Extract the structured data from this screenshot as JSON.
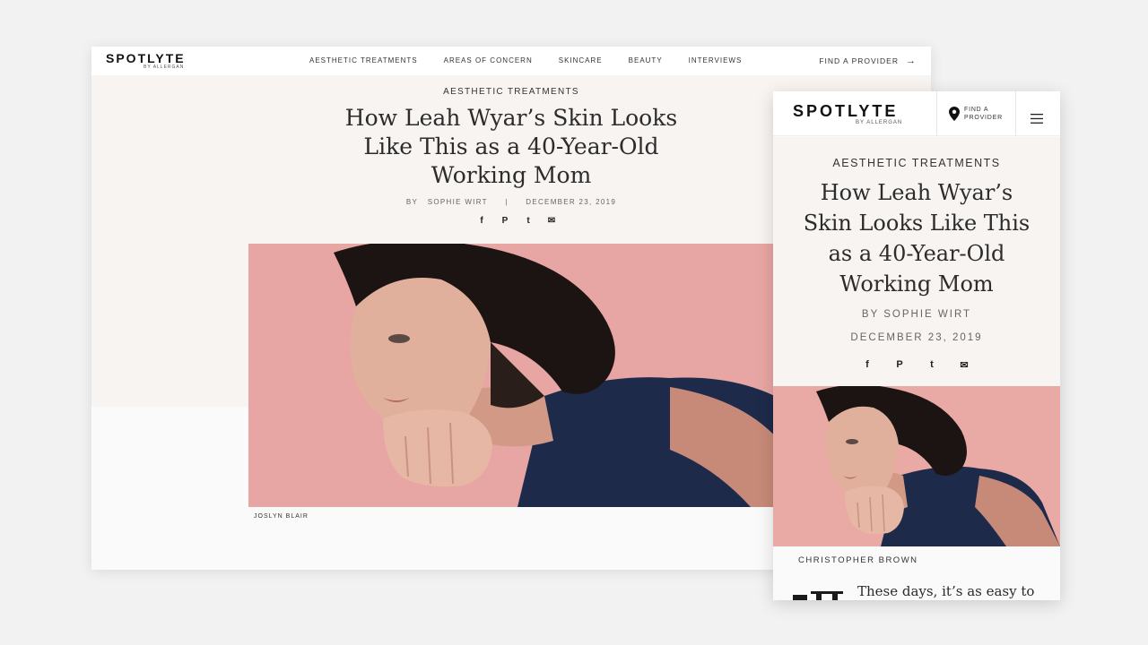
{
  "desktop": {
    "logo": {
      "wordmark": "SPOTLYTE",
      "sub": "BY ALLERGAN"
    },
    "nav": [
      "AESTHETIC TREATMENTS",
      "AREAS OF CONCERN",
      "SKINCARE",
      "BEAUTY",
      "INTERVIEWS"
    ],
    "find_provider": "FIND A PROVIDER",
    "find_provider_arrow": "→",
    "article": {
      "category": "AESTHETIC TREATMENTS",
      "title": "How Leah Wyar’s Skin Looks Like This as a 40-Year-Old Working Mom",
      "by": "BY",
      "author": "SOPHIE WIRT",
      "separator": "|",
      "date": "DECEMBER 23, 2019",
      "share": [
        "f",
        "P",
        "t",
        "✉"
      ],
      "photo_caption": "JOSLYN BLAIR"
    }
  },
  "mobile": {
    "logo": {
      "wordmark": "SPOTLYTE",
      "sub": "BY ALLERGAN"
    },
    "find_provider": "FIND A PROVIDER",
    "article": {
      "category": "AESTHETIC TREATMENTS",
      "title": "How Leah Wyar’s Skin Looks Like This as a 40-Year-Old Working Mom",
      "author_line": "BY SOPHIE WIRT",
      "date": "DECEMBER 23, 2019",
      "share": [
        "f",
        "P",
        "t",
        "✉"
      ],
      "photo_caption": "CHRISTOPHER BROWN",
      "body_start": "These days, it’s as easy to"
    }
  },
  "colors": {
    "background": "#f2f2f3",
    "hero_tint": "#f8f4f1",
    "photo_pink": "#e8a8a4",
    "shirt_navy": "#1e2a4a",
    "hair": "#1c1412"
  }
}
